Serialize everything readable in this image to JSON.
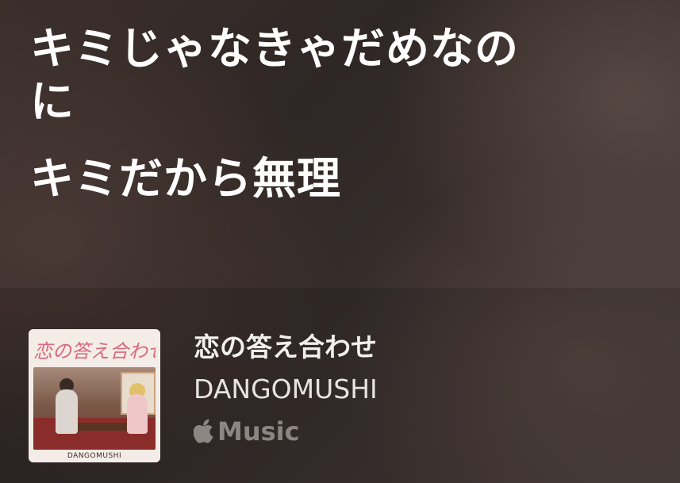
{
  "lyrics": {
    "lines": [
      "キミじゃなきゃだめなの",
      "に",
      "キミだから無理"
    ]
  },
  "now_playing": {
    "album_art": {
      "title_text": "恋の答え合わせ",
      "caption": "DANGOMUSHI"
    },
    "song_title": "恋の答え合わせ",
    "artist": "DANGOMUSHI",
    "service": {
      "icon": "apple-icon",
      "label": "Music"
    }
  },
  "colors": {
    "text_primary": "#ffffff",
    "text_secondary": "#e7e3e1",
    "service_gray": "#8c8582"
  }
}
